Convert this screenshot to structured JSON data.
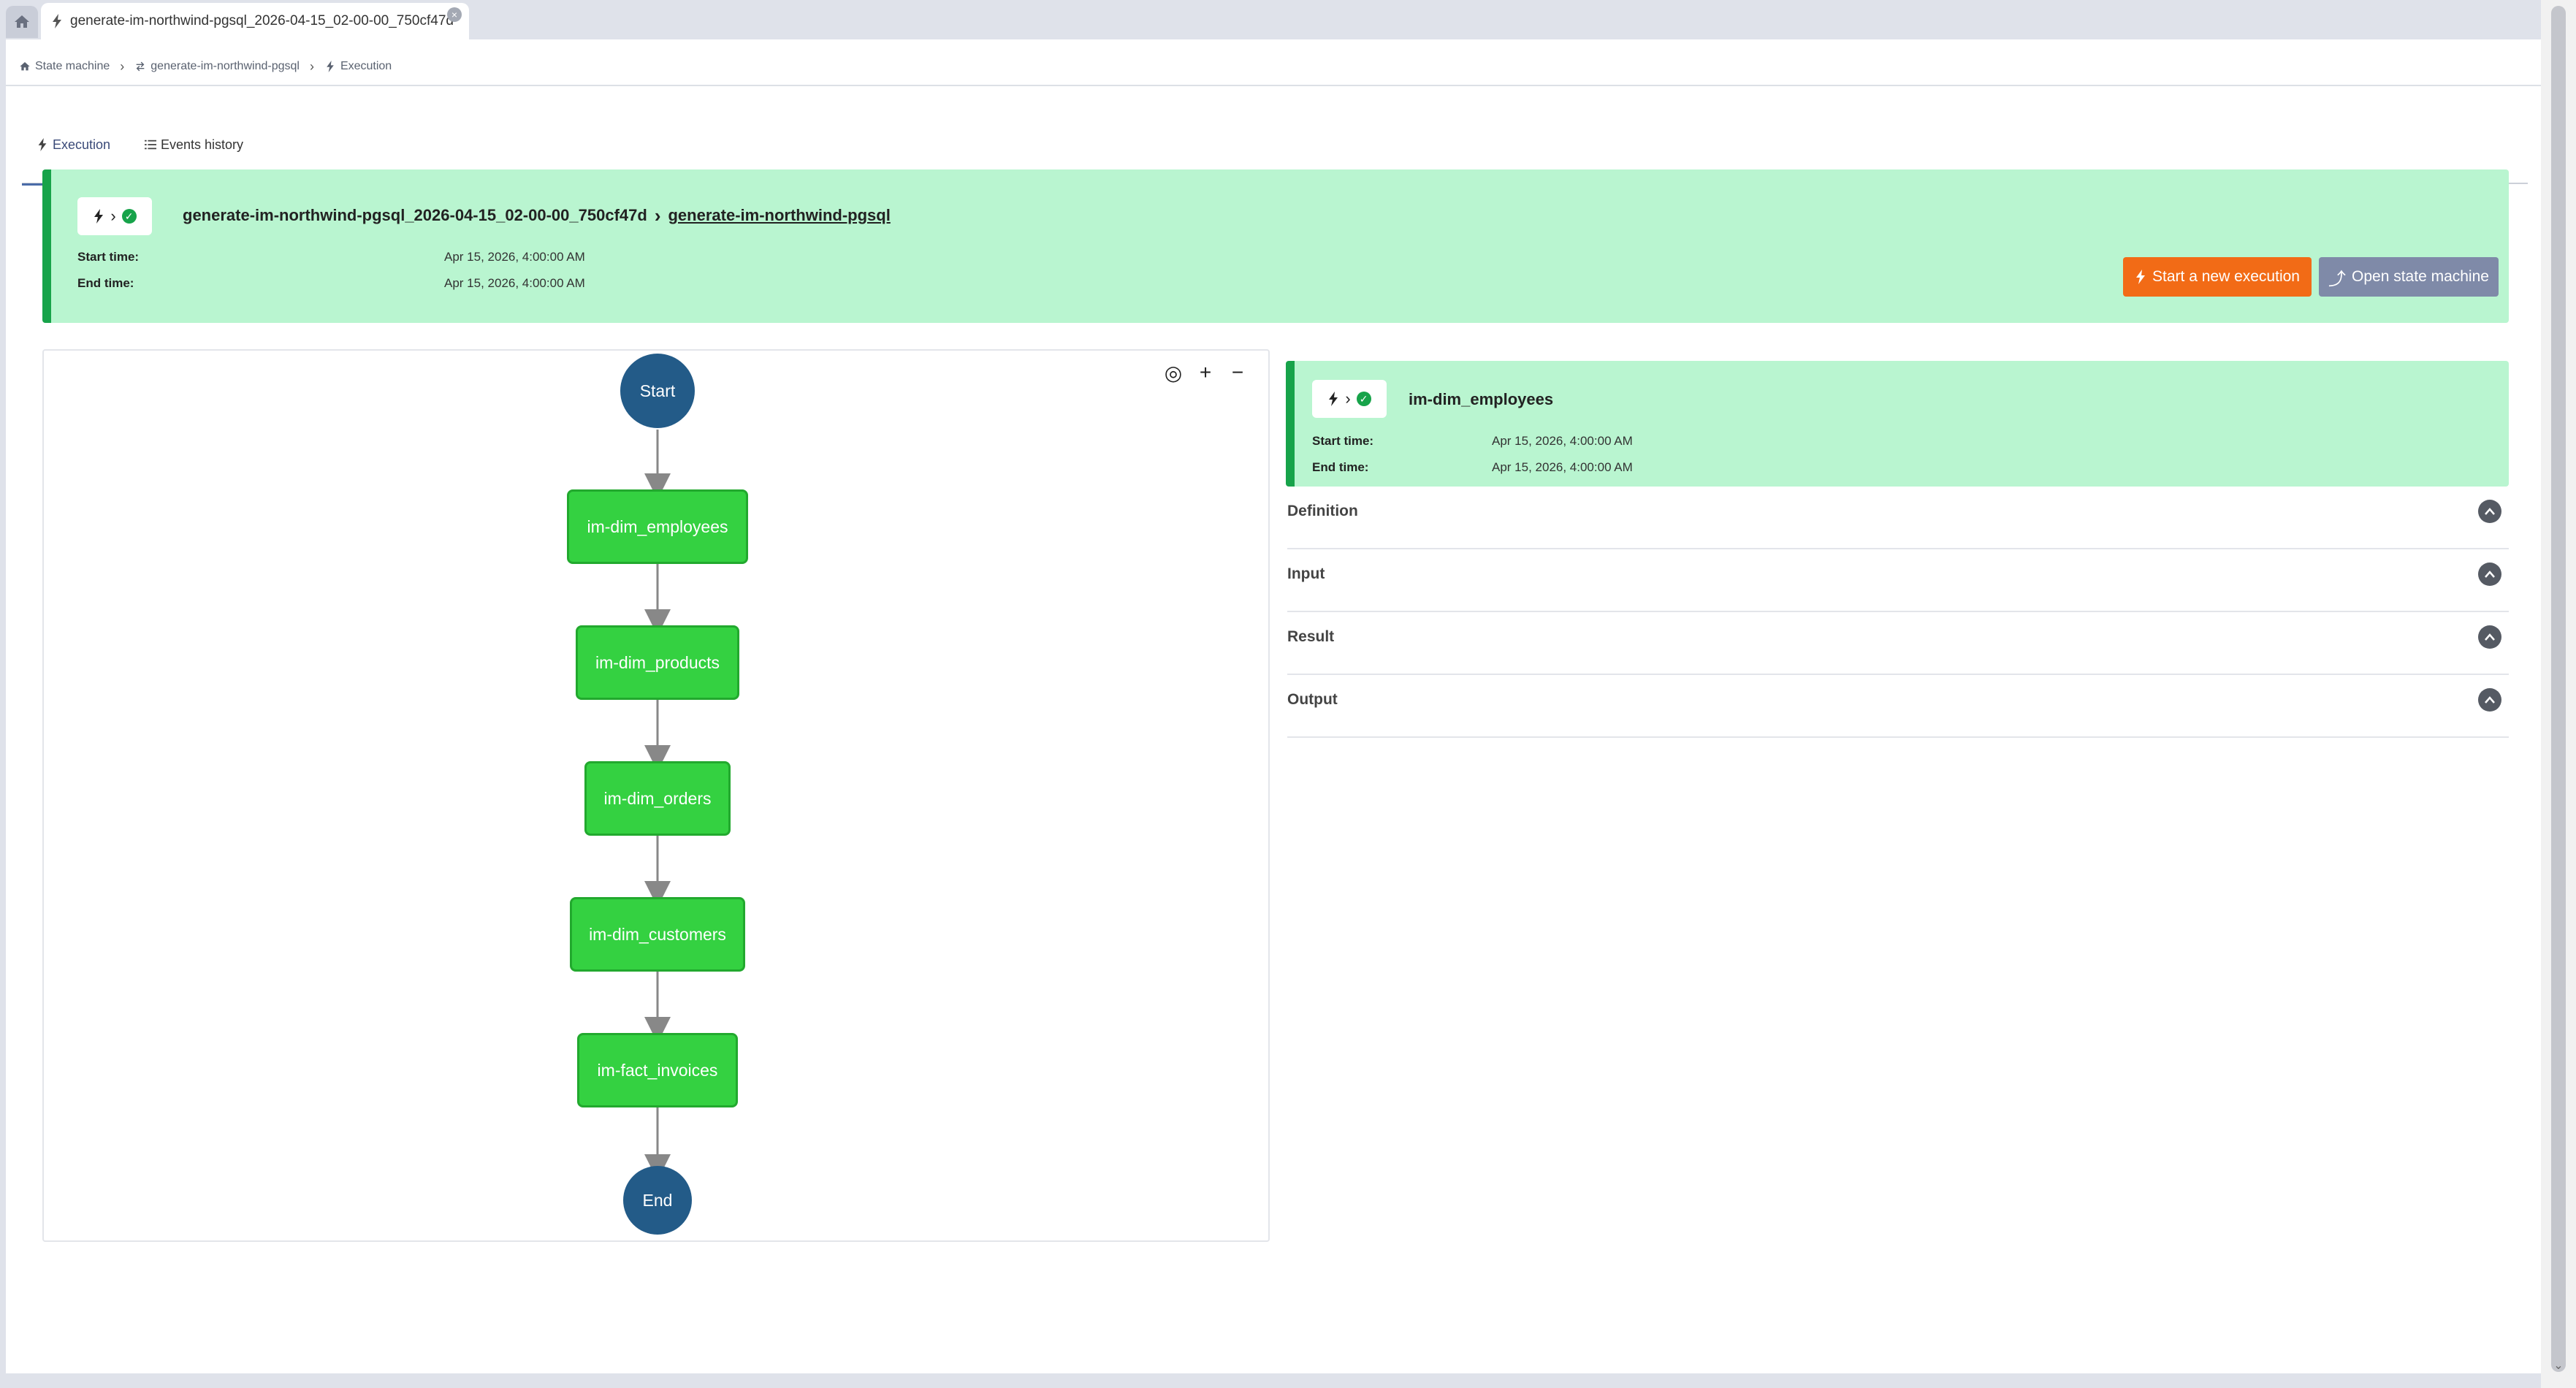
{
  "window": {
    "tab_title": "generate-im-northwind-pgsql_2026-04-15_02-00-00_750cf47d"
  },
  "breadcrumb": [
    {
      "label": "State machine"
    },
    {
      "label": "generate-im-northwind-pgsql"
    },
    {
      "label": "Execution"
    }
  ],
  "tabs": [
    {
      "label": "Execution",
      "active": true
    },
    {
      "label": "Events history",
      "active": false
    }
  ],
  "execution": {
    "name": "generate-im-northwind-pgsql_2026-04-15_02-00-00_750cf47d",
    "state_machine": "generate-im-northwind-pgsql",
    "start_label": "Start time:",
    "start_value": "Apr 15, 2026, 4:00:00 AM",
    "end_label": "End time:",
    "end_value": "Apr 15, 2026, 4:00:00 AM",
    "status": "succeeded",
    "status_color": "#17a34a",
    "btn_start": "Start a new execution",
    "btn_open": "Open state machine"
  },
  "graph": {
    "tools": [
      "target-icon",
      "plus-icon",
      "minus-icon"
    ],
    "nodes": [
      {
        "label": "Start",
        "kind": "terminal"
      },
      {
        "label": "im-dim_employees",
        "kind": "task"
      },
      {
        "label": "im-dim_products",
        "kind": "task"
      },
      {
        "label": "im-dim_orders",
        "kind": "task"
      },
      {
        "label": "im-dim_customers",
        "kind": "task"
      },
      {
        "label": "im-fact_invoices",
        "kind": "task"
      },
      {
        "label": "End",
        "kind": "terminal"
      }
    ]
  },
  "selected_state": {
    "name": "im-dim_employees",
    "start_label": "Start time:",
    "start_value": "Apr 15, 2026, 4:00:00 AM",
    "end_label": "End time:",
    "end_value": "Apr 15, 2026, 4:00:00 AM"
  },
  "sections": [
    {
      "label": "Definition"
    },
    {
      "label": "Input"
    },
    {
      "label": "Result"
    },
    {
      "label": "Output"
    }
  ],
  "colors": {
    "success_bg": "#b9f5d0",
    "node_task": "#34d141",
    "node_terminal": "#235b88",
    "btn_primary": "#f26b16",
    "btn_secondary": "#7f8aa8"
  }
}
